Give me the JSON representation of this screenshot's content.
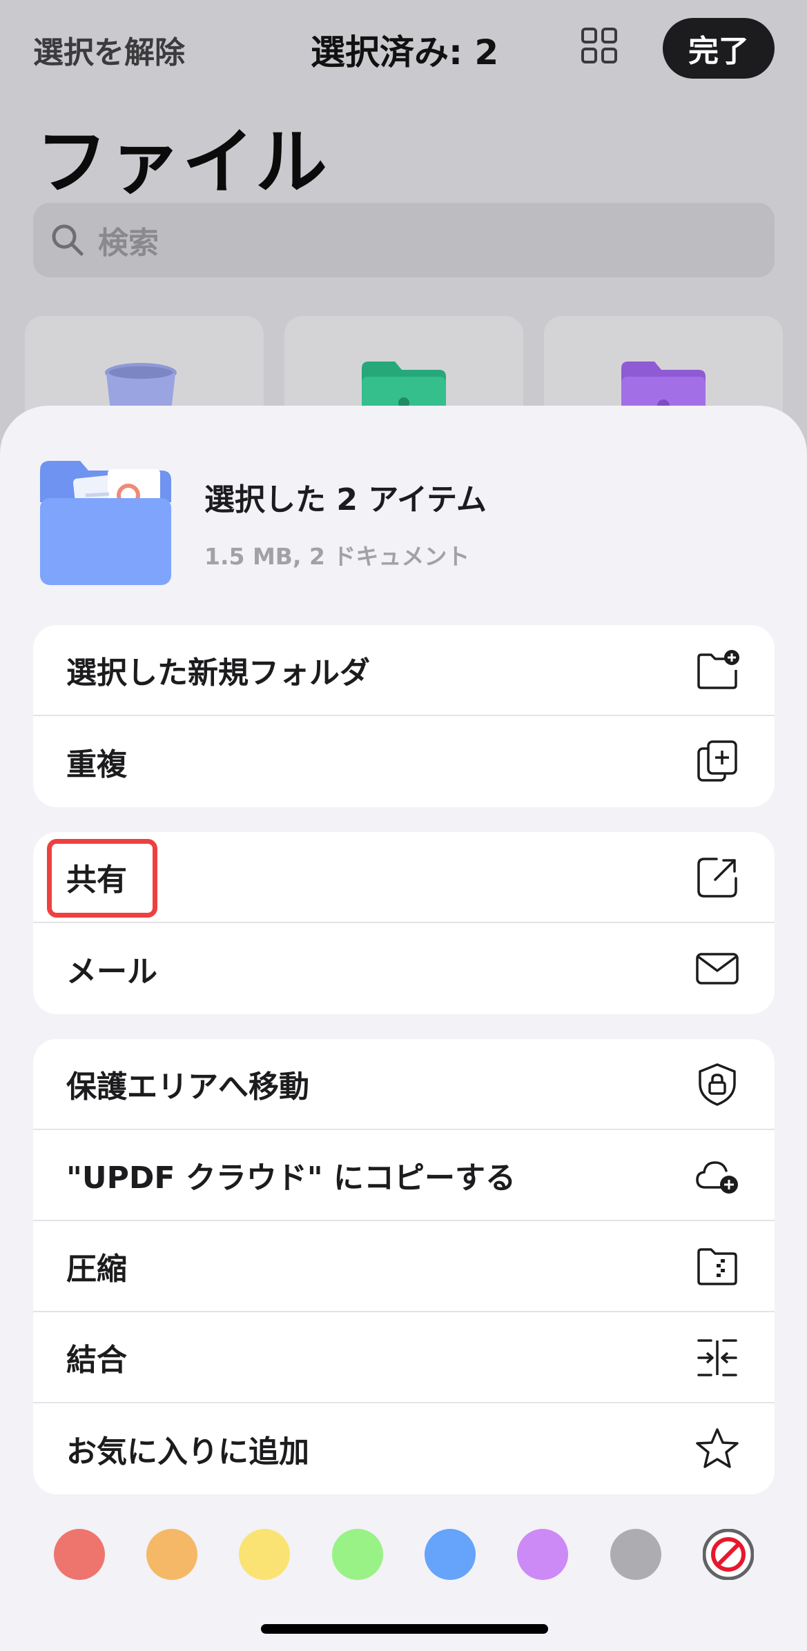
{
  "nav": {
    "deselect_label": "選択を解除",
    "title": "選択済み: 2",
    "done_label": "完了"
  },
  "page_title": "ファイル",
  "search": {
    "placeholder": "検索"
  },
  "sheet": {
    "title": "選択した 2 アイテム",
    "subtitle": "1.5 MB, 2 ドキュメント",
    "groups": [
      [
        {
          "label": "選択した新規フォルダ",
          "icon": "folder-plus-icon"
        },
        {
          "label": "重複",
          "icon": "duplicate-icon"
        }
      ],
      [
        {
          "label": "共有",
          "icon": "share-icon"
        },
        {
          "label": "メール",
          "icon": "mail-icon"
        }
      ],
      [
        {
          "label": "保護エリアへ移動",
          "icon": "shield-lock-icon"
        },
        {
          "label": " \"UPDF クラウド\" にコピーする",
          "icon": "cloud-plus-icon"
        },
        {
          "label": "圧縮",
          "icon": "zip-folder-icon"
        },
        {
          "label": "結合",
          "icon": "merge-icon"
        },
        {
          "label": "お気に入りに追加",
          "icon": "star-icon"
        }
      ]
    ],
    "color_tags": [
      "#ee756d",
      "#f5b866",
      "#fbe373",
      "#98f285",
      "#66a3fb",
      "#cc8af6",
      "#adadb1",
      "none"
    ]
  }
}
